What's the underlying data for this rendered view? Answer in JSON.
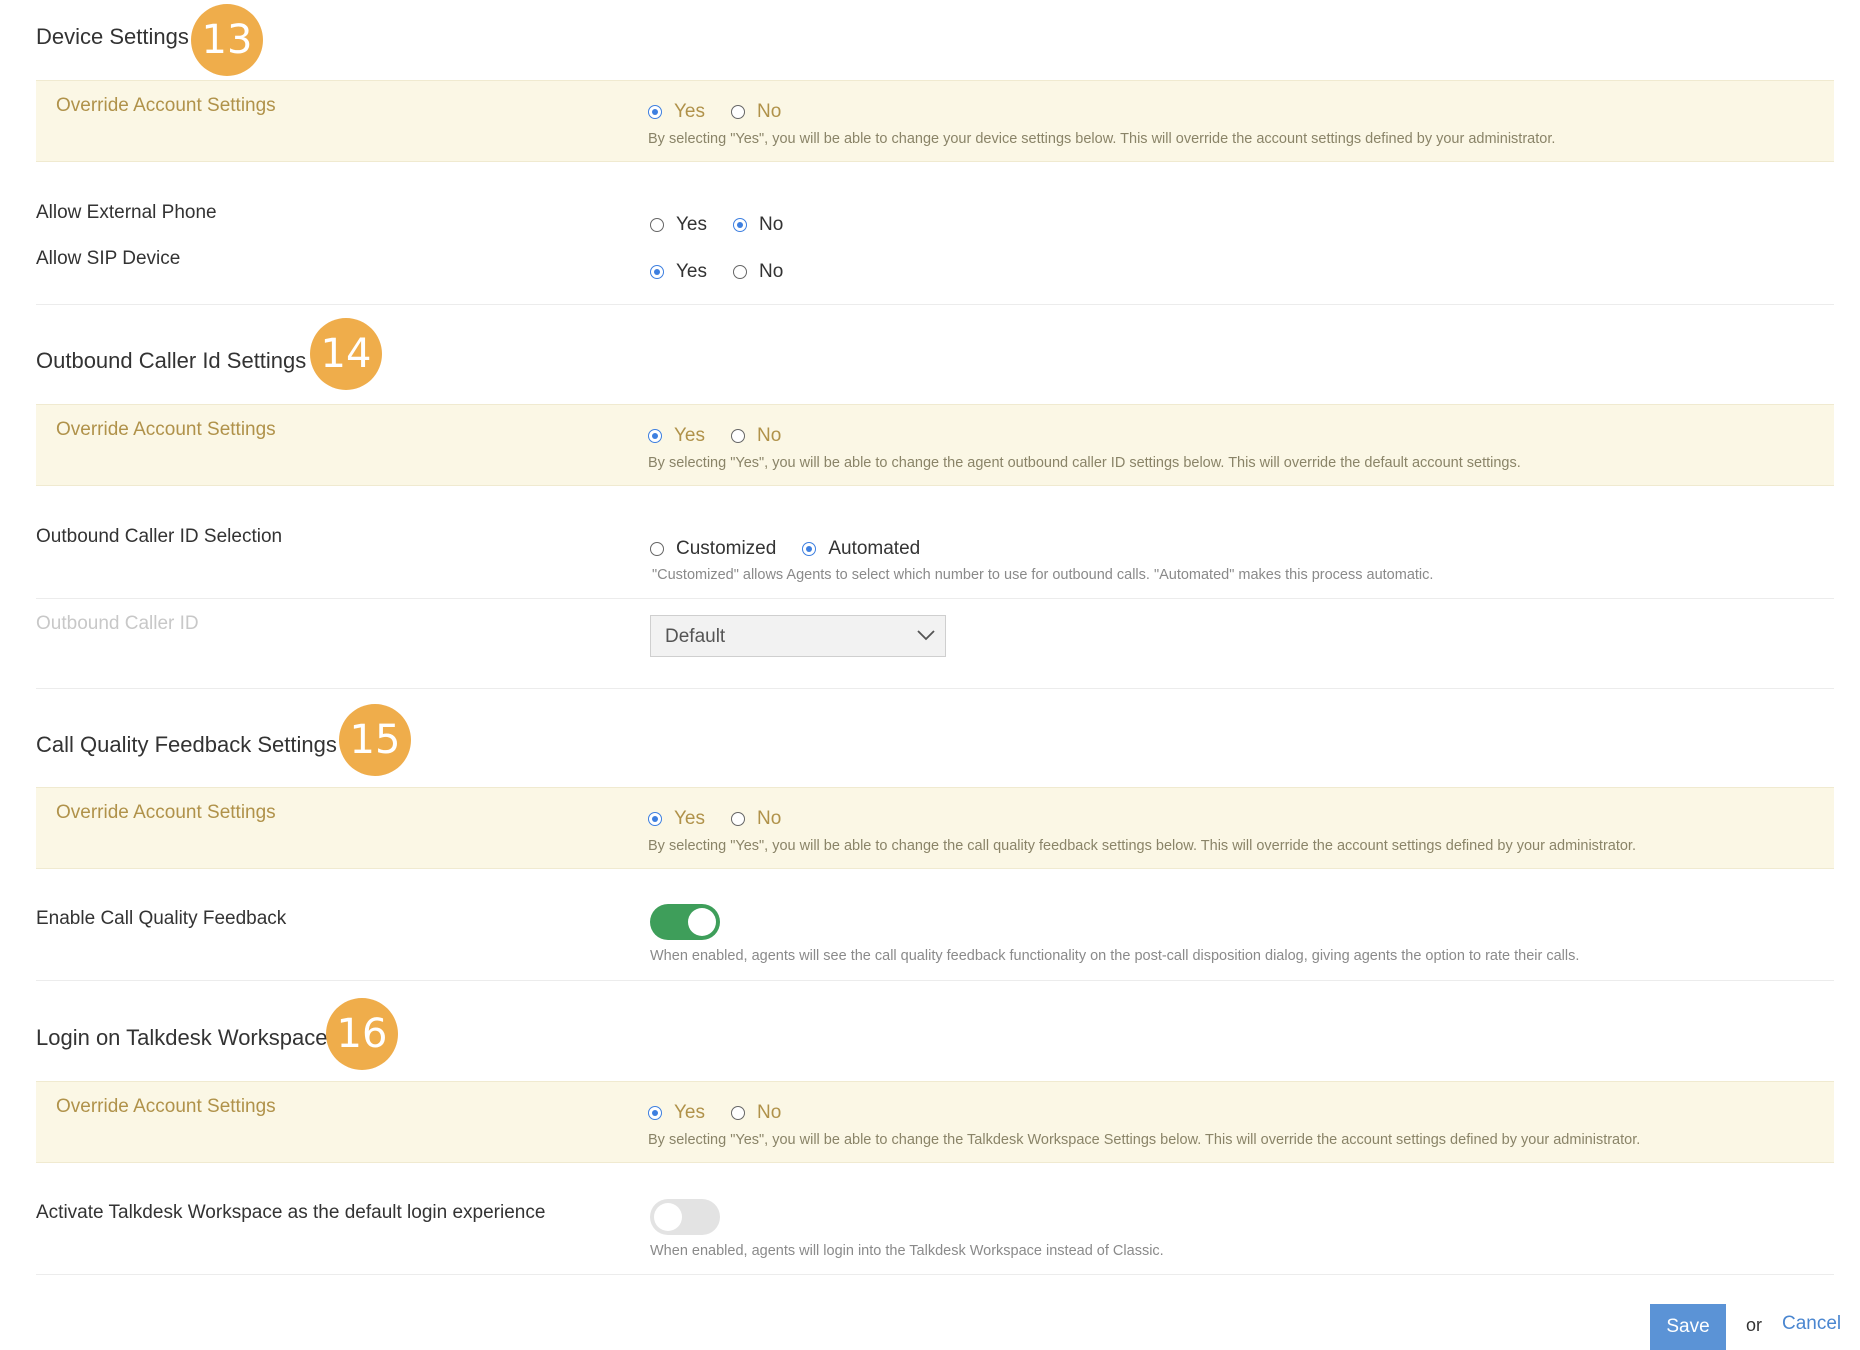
{
  "sections": [
    {
      "title": "Device Settings",
      "badge": "13",
      "override": {
        "label": "Override Account Settings",
        "options": [
          "Yes",
          "No"
        ],
        "selected": "Yes",
        "help": "By selecting \"Yes\", you will be able to change your device settings below. This will override the account settings defined by your administrator."
      },
      "rows": [
        {
          "label": "Allow External Phone",
          "options": [
            "Yes",
            "No"
          ],
          "selected": "No"
        },
        {
          "label": "Allow SIP Device",
          "options": [
            "Yes",
            "No"
          ],
          "selected": "Yes"
        }
      ]
    },
    {
      "title": "Outbound Caller Id Settings",
      "badge": "14",
      "override": {
        "label": "Override Account Settings",
        "options": [
          "Yes",
          "No"
        ],
        "selected": "Yes",
        "help": "By selecting \"Yes\", you will be able to change the agent outbound caller ID settings below. This will override the default account settings."
      },
      "selection": {
        "label": "Outbound Caller ID Selection",
        "options": [
          "Customized",
          "Automated"
        ],
        "selected": "Automated",
        "help": "\"Customized\" allows Agents to select which number to use for outbound calls. \"Automated\" makes this process automatic."
      },
      "caller_id": {
        "label": "Outbound Caller ID",
        "value": "Default"
      }
    },
    {
      "title": "Call Quality Feedback Settings",
      "badge": "15",
      "override": {
        "label": "Override Account Settings",
        "options": [
          "Yes",
          "No"
        ],
        "selected": "Yes",
        "help": "By selecting \"Yes\", you will be able to change the call quality feedback settings below. This will override the account settings defined by your administrator."
      },
      "toggle": {
        "label": "Enable Call Quality Feedback",
        "on": true,
        "help": "When enabled, agents will see the call quality feedback functionality on the post-call disposition dialog, giving agents the option to rate their calls."
      }
    },
    {
      "title": "Login on Talkdesk Workspace",
      "badge": "16",
      "override": {
        "label": "Override Account Settings",
        "options": [
          "Yes",
          "No"
        ],
        "selected": "Yes",
        "help": "By selecting \"Yes\", you will be able to change the Talkdesk Workspace Settings below. This will override the account settings defined by your administrator."
      },
      "toggle": {
        "label": "Activate Talkdesk Workspace as the default login experience",
        "on": false,
        "help": "When enabled, agents will login into the Talkdesk Workspace instead of Classic."
      }
    }
  ],
  "footer": {
    "save": "Save",
    "or": "or",
    "cancel": "Cancel"
  },
  "colors": {
    "badge": "#efad4b",
    "accent": "#3d7fe0",
    "toggle_on": "#3e9e5a",
    "override_bg": "#fbf7e5"
  }
}
